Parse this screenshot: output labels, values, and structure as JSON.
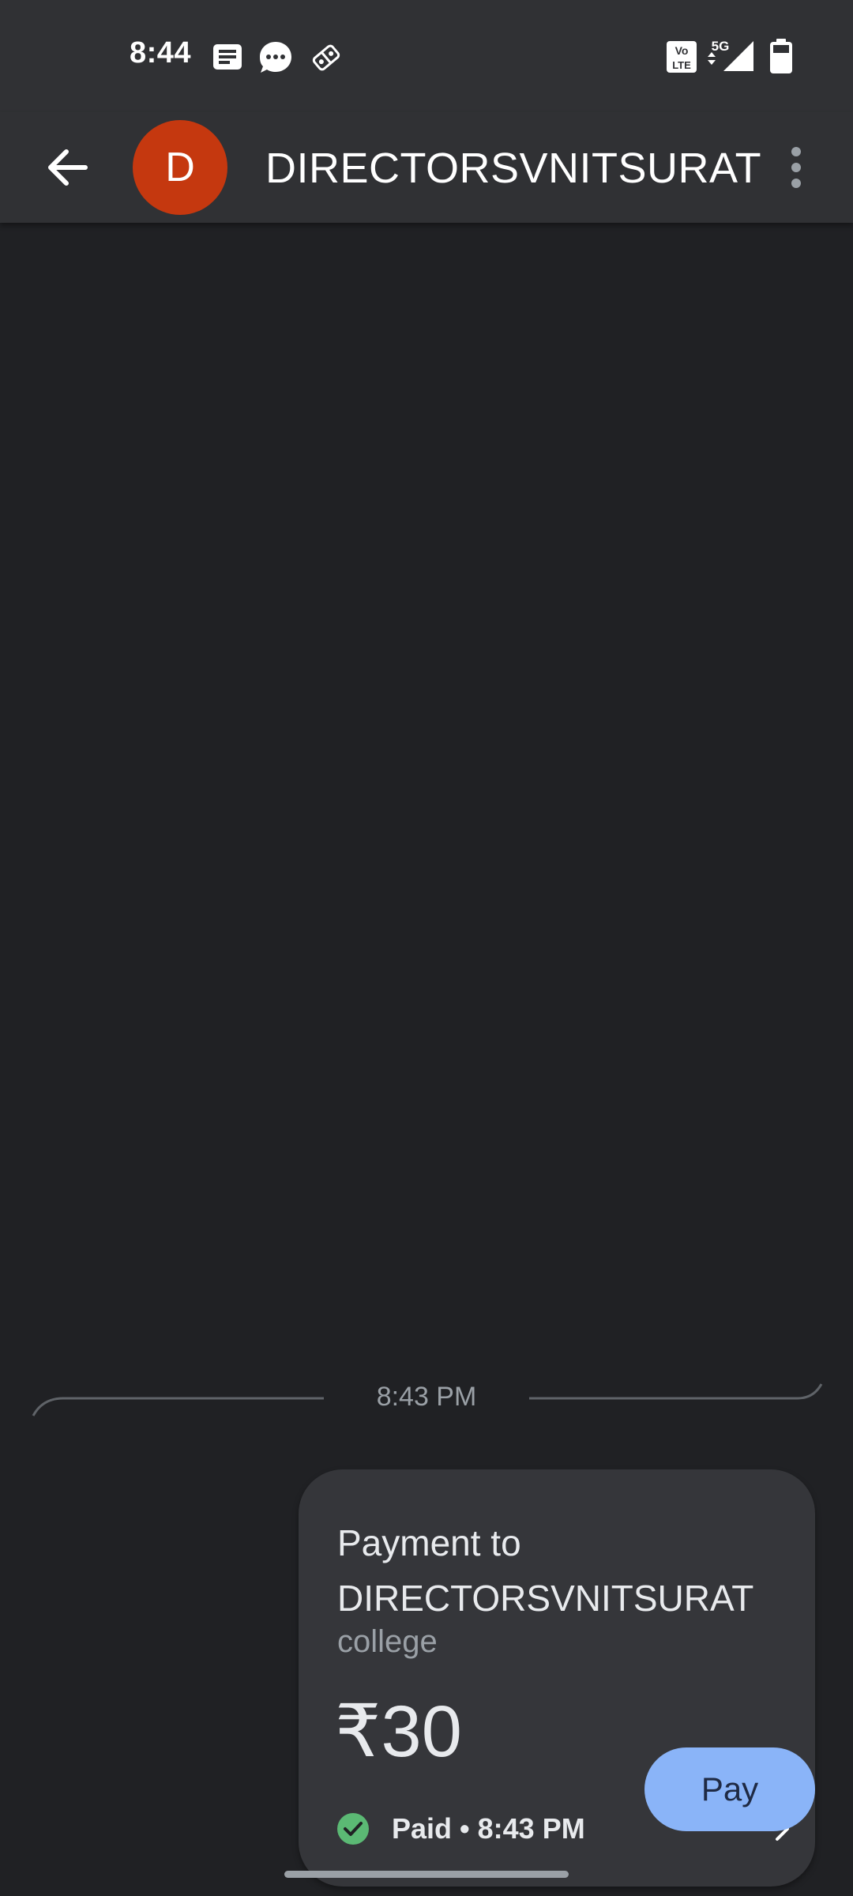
{
  "status_bar": {
    "time": "8:44",
    "notification_icons": [
      "news-icon",
      "message-bubble-icon",
      "domino-icon"
    ],
    "system_icons": [
      "volte-icon",
      "5g-data-icon",
      "signal-icon",
      "battery-icon"
    ],
    "network_label": "5G"
  },
  "header": {
    "avatar_letter": "D",
    "title": "DIRECTORSVNITSURAT",
    "avatar_color": "#c5380f"
  },
  "chat": {
    "divider_time": "8:43 PM",
    "payment": {
      "title": "Payment to DIRECTORSVNITSURAT",
      "note": "college",
      "amount": "₹30",
      "status": "Paid • 8:43 PM",
      "status_color": "#5bb974"
    }
  },
  "actions": {
    "pay_label": "Pay",
    "pay_color": "#8ab4f8"
  }
}
